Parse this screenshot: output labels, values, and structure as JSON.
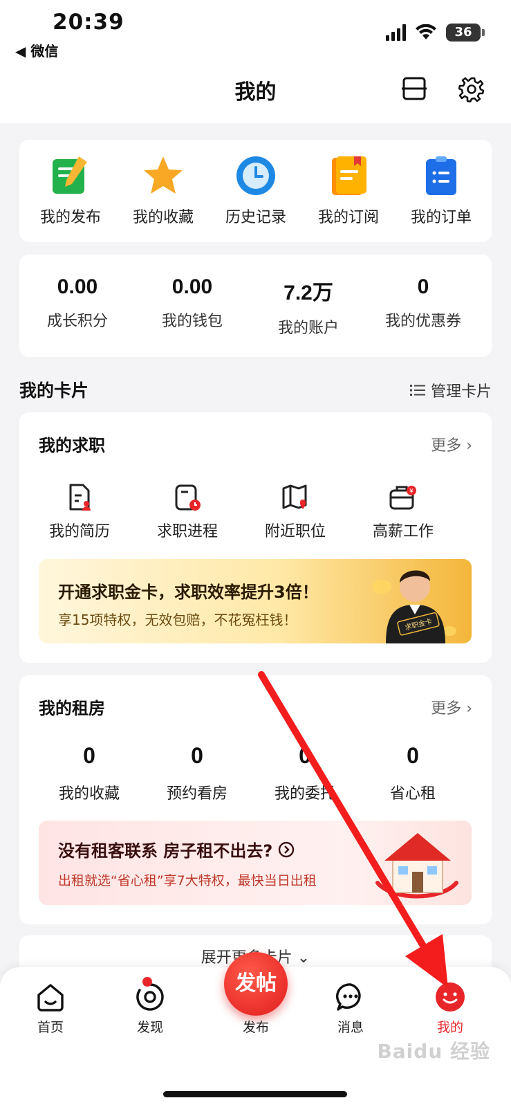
{
  "status_bar": {
    "time": "20:39",
    "back_app": "◀ 微信",
    "battery": "36"
  },
  "header": {
    "title": "我的"
  },
  "quick_actions": [
    {
      "label": "我的发布",
      "icon": "edit-document-icon"
    },
    {
      "label": "我的收藏",
      "icon": "star-icon"
    },
    {
      "label": "历史记录",
      "icon": "clock-icon"
    },
    {
      "label": "我的订阅",
      "icon": "subscription-icon"
    },
    {
      "label": "我的订单",
      "icon": "order-list-icon"
    }
  ],
  "stats": [
    {
      "value": "0.00",
      "label": "成长积分"
    },
    {
      "value": "0.00",
      "label": "我的钱包"
    },
    {
      "value": "7.2万",
      "label": "我的账户"
    },
    {
      "value": "0",
      "label": "我的优惠券"
    }
  ],
  "cards_section": {
    "title": "我的卡片",
    "manage": "管理卡片"
  },
  "job_card": {
    "title": "我的求职",
    "more": "更多 ›",
    "items": [
      {
        "label": "我的简历",
        "icon": "resume-icon"
      },
      {
        "label": "求职进程",
        "icon": "job-progress-icon"
      },
      {
        "label": "附近职位",
        "icon": "map-pin-icon"
      },
      {
        "label": "高薪工作",
        "icon": "briefcase-icon"
      }
    ],
    "banner": {
      "title": "开通求职金卡，求职效率提升3倍！",
      "subtitle": "享15项特权，无效包赔，不花冤枉钱！",
      "badge": "求职金卡"
    }
  },
  "rent_card": {
    "title": "我的租房",
    "more": "更多 ›",
    "items": [
      {
        "value": "0",
        "label": "我的收藏"
      },
      {
        "value": "0",
        "label": "预约看房"
      },
      {
        "value": "0",
        "label": "我的委托"
      },
      {
        "value": "0",
        "label": "省心租"
      }
    ],
    "banner": {
      "title": "没有租客联系 房子租不出去?",
      "subtitle": "出租就选“省心租”享7大特权，最快当日出租"
    }
  },
  "expand": {
    "label": "展开更多卡片 ⌄"
  },
  "tabbar": {
    "items": [
      {
        "label": "首页",
        "icon": "home-icon"
      },
      {
        "label": "发现",
        "icon": "discover-icon"
      },
      {
        "label": "发布",
        "button": "发帖"
      },
      {
        "label": "消息",
        "icon": "message-icon"
      },
      {
        "label": "我的",
        "icon": "profile-icon"
      }
    ]
  },
  "colors": {
    "accent": "#e8262a",
    "gold": "#f3b63a"
  },
  "watermark": "Baidu 经验"
}
